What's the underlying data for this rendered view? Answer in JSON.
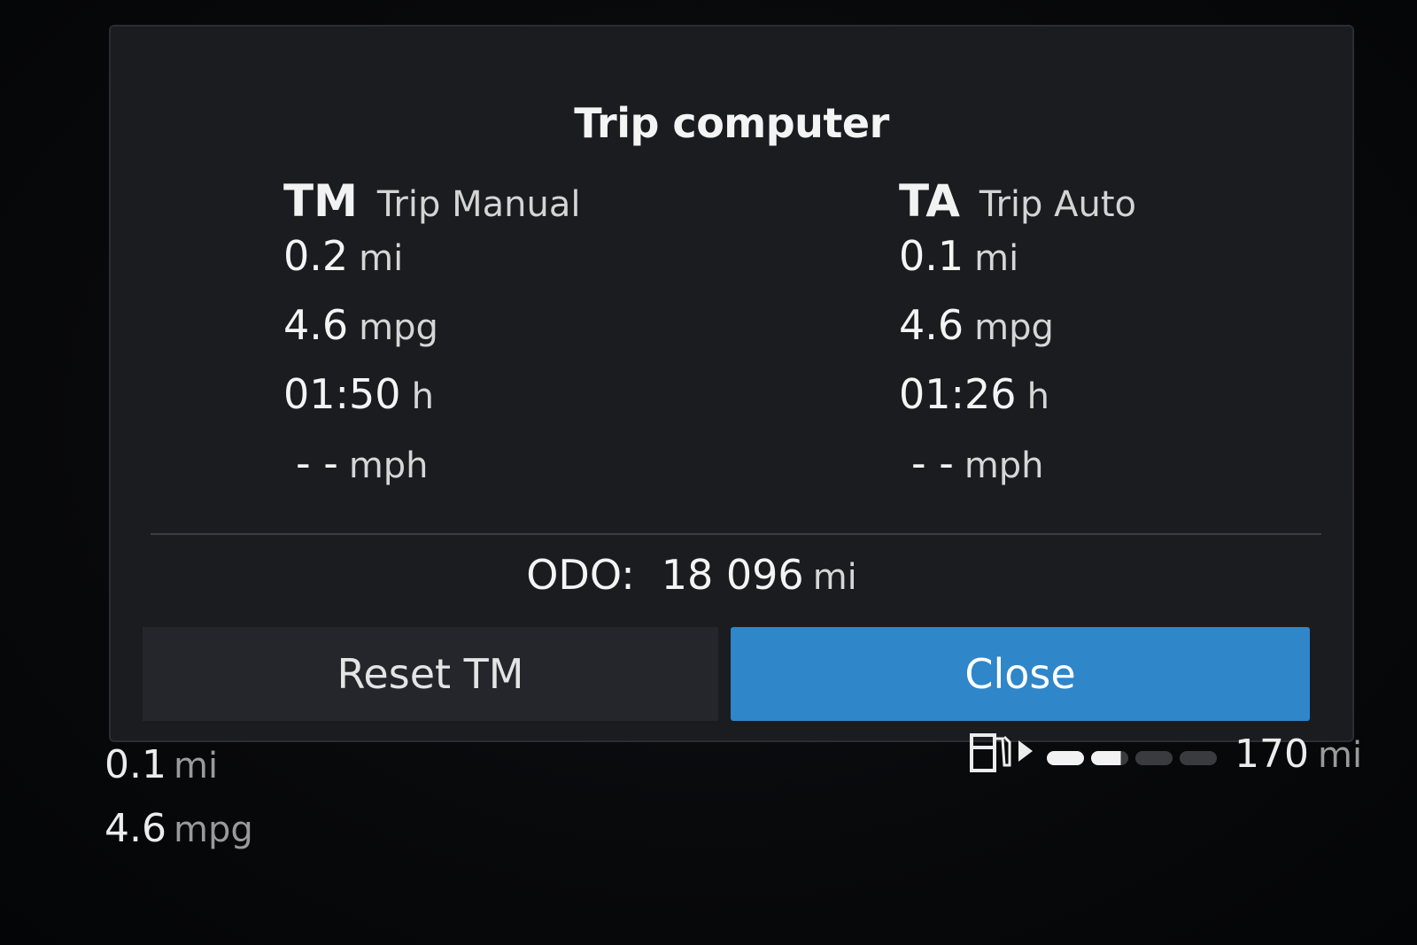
{
  "dialog": {
    "title": "Trip computer",
    "trip_manual": {
      "abbr": "TM",
      "label": "Trip Manual",
      "distance": {
        "value": "0.2",
        "unit": "mi"
      },
      "consumption": {
        "value": "4.6",
        "unit": "mpg"
      },
      "time": {
        "value": "01:50",
        "unit": "h"
      },
      "speed": {
        "value": "- -",
        "unit": "mph"
      }
    },
    "trip_auto": {
      "abbr": "TA",
      "label": "Trip Auto",
      "distance": {
        "value": "0.1",
        "unit": "mi"
      },
      "consumption": {
        "value": "4.6",
        "unit": "mpg"
      },
      "time": {
        "value": "01:26",
        "unit": "h"
      },
      "speed": {
        "value": "- -",
        "unit": "mph"
      }
    },
    "odometer": {
      "label": "ODO:",
      "value": "18 096",
      "unit": "mi"
    },
    "buttons": {
      "reset": "Reset TM",
      "close": "Close"
    }
  },
  "cluster": {
    "trip_distance": {
      "value": "0.1",
      "unit": "mi"
    },
    "trip_consumption": {
      "value": "4.6",
      "unit": "mpg"
    },
    "fuel": {
      "icon": "fuel-pump-icon",
      "level_fraction": 0.45,
      "range": "170",
      "unit": "mi"
    }
  },
  "colors": {
    "accent": "#2f86c9",
    "dialog_bg": "#1b1c20",
    "button_bg": "#25262b"
  }
}
